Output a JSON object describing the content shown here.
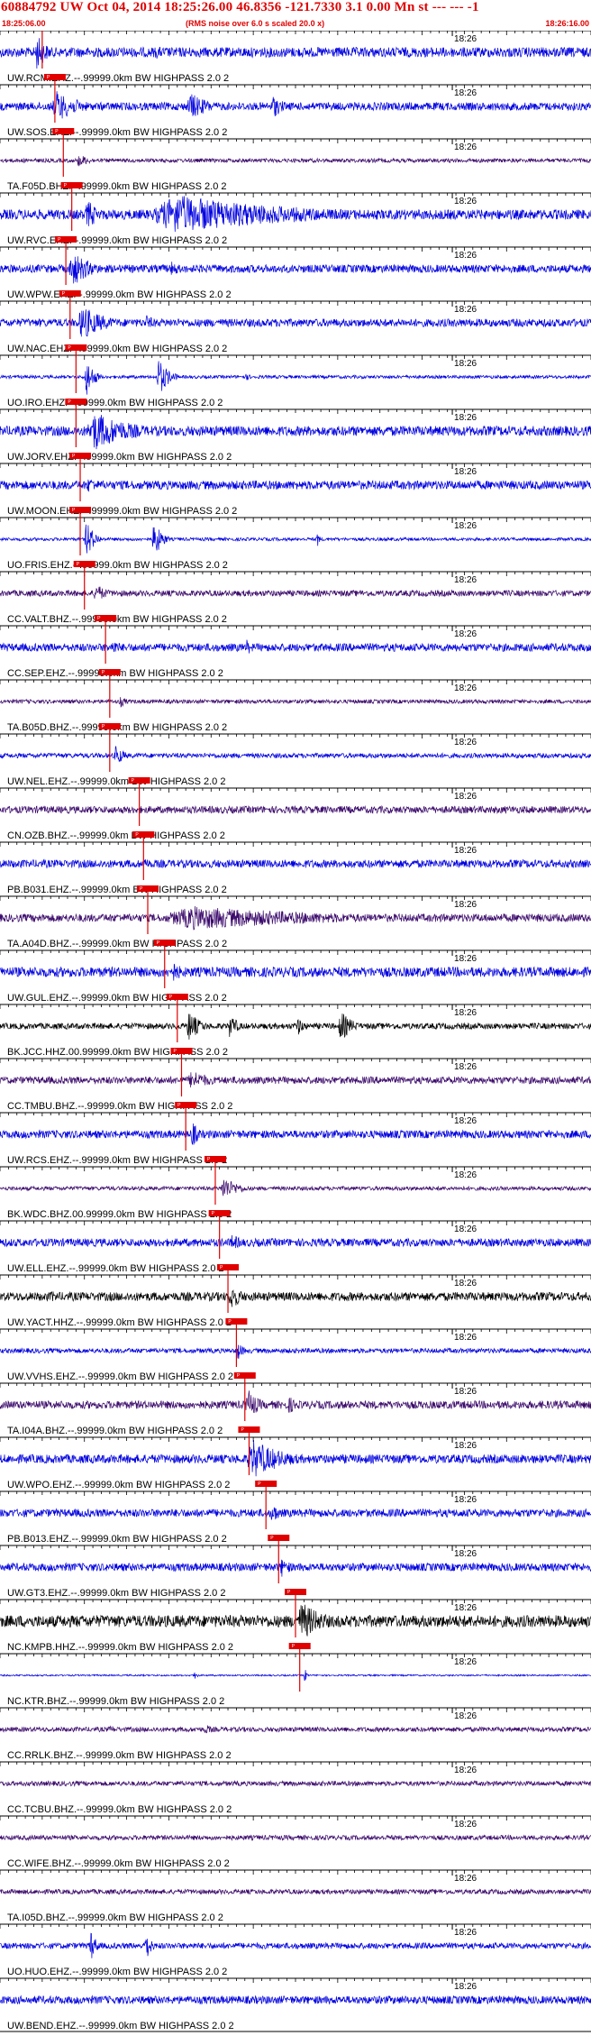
{
  "header": {
    "title": "60884792 UW Oct 04, 2014 18:25:26.00   46.8356 -121.7330  3.1 0.00 Mn st --- --- -1",
    "start_time": "18:25:06.00",
    "end_time": "18:26:16.00",
    "note": "(RMS noise over 6.0 s scaled 20.0 x)"
  },
  "colors": {
    "blue": "#0000e0",
    "purple": "#3b0a6b",
    "black": "#000000",
    "pick": "#e00000",
    "tick": "#000000"
  },
  "chart_data": {
    "type": "seismogram",
    "time_start_s": 0,
    "time_end_s": 70,
    "minute_mark_label": "18:26",
    "minute_mark_s": 54,
    "pick_tag": "P",
    "traces": [
      {
        "label": "UW.RCM.EHZ.--.99999.0km BW  HIGHPASS  2.0  2",
        "color": "blue",
        "pick": 5,
        "events": [
          [
            4,
            3,
            0.9
          ],
          [
            18,
            4,
            0.35
          ]
        ],
        "noise": 0.25
      },
      {
        "label": "UW.SOS.EHZ.--.99999.0km BW  HIGHPASS  2.0  2",
        "color": "blue",
        "pick": 6.5,
        "events": [
          [
            6,
            6,
            0.8
          ],
          [
            22,
            5,
            0.7
          ],
          [
            32,
            3,
            0.6
          ]
        ],
        "noise": 0.2
      },
      {
        "label": "TA.F05D.BHZ.--.99999.0km BW  HIGHPASS  2.0  2",
        "color": "purple",
        "pick": 7.5,
        "events": [
          [
            9,
            3,
            0.35
          ]
        ],
        "noise": 0.1
      },
      {
        "label": "UW.RVC.EHZ.--.99999.0km BW  HIGHPASS  2.0  2",
        "color": "blue",
        "pick": 8.5,
        "events": [
          [
            10,
            3,
            0.8
          ],
          [
            17,
            32,
            1.0
          ]
        ],
        "noise": 0.25
      },
      {
        "label": "UW.WPW.EHZ.--.99999.0km BW  HIGHPASS  2.0  2",
        "color": "blue",
        "pick": 7.8,
        "events": [
          [
            8,
            5,
            0.9
          ],
          [
            20,
            3,
            0.4
          ]
        ],
        "noise": 0.2
      },
      {
        "label": "UW.NAC.EHZ.--.99999.0km BW  HIGHPASS  2.0  2",
        "color": "blue",
        "pick": 8.3,
        "events": [
          [
            9,
            6,
            0.9
          ],
          [
            17,
            3,
            0.4
          ]
        ],
        "noise": 0.2
      },
      {
        "label": "UO.IRO.EHZ.--.99999.0km BW  HIGHPASS  2.0  2",
        "color": "blue",
        "pick": 9,
        "events": [
          [
            10,
            2,
            1.0
          ],
          [
            18.5,
            2.5,
            1.0
          ],
          [
            29,
            1.5,
            0.2
          ]
        ],
        "noise": 0.08
      },
      {
        "label": "UW.JORV.EHZ.--.99999.0km BW  HIGHPASS  2.0  2",
        "color": "blue",
        "pick": 9,
        "events": [
          [
            10,
            10,
            1.0
          ]
        ],
        "noise": 0.25
      },
      {
        "label": "UW.MOON.EHZ.--.99999.0km BW  HIGHPASS  2.0  2",
        "color": "blue",
        "pick": 9.5,
        "events": [
          [
            10,
            4,
            0.4
          ]
        ],
        "noise": 0.22
      },
      {
        "label": "UO.FRIS.EHZ.--.99999.0km BW  HIGHPASS  2.0  2",
        "color": "blue",
        "pick": 9.5,
        "events": [
          [
            10,
            2,
            1.0
          ],
          [
            18,
            2,
            1.0
          ],
          [
            37.5,
            0.5,
            0.6
          ]
        ],
        "noise": 0.08
      },
      {
        "label": "CC.VALT.BHZ.--.99999.0km BW  HIGHPASS  2.0  2",
        "color": "purple",
        "pick": 10,
        "events": [
          [
            11,
            3,
            0.5
          ]
        ],
        "noise": 0.15
      },
      {
        "label": "CC.SEP.EHZ.--.99999.0km BW  HIGHPASS  2.0  2",
        "color": "blue",
        "pick": 12.5,
        "events": [
          [
            13,
            3,
            0.4
          ],
          [
            29,
            2,
            0.4
          ]
        ],
        "noise": 0.2
      },
      {
        "label": "TA.B05D.BHZ.--.99999.0km BW  HIGHPASS  2.0  2",
        "color": "purple",
        "pick": 13,
        "events": [
          [
            14,
            2,
            0.3
          ]
        ],
        "noise": 0.1
      },
      {
        "label": "UW.NEL.EHZ.--.99999.0km BW  HIGHPASS  2.0  2",
        "color": "blue",
        "pick": 13,
        "events": [
          [
            13.5,
            2,
            0.6
          ]
        ],
        "noise": 0.12
      },
      {
        "label": "CN.OZB.BHZ.--.99999.0km BW  HIGHPASS  2.0  2",
        "color": "purple",
        "pick": 16.5,
        "events": [],
        "noise": 0.18
      },
      {
        "label": "PB.B031.EHZ.--.99999.0km BW  HIGHPASS  2.0  2",
        "color": "blue",
        "pick": 17,
        "events": [
          [
            17,
            1,
            0.5
          ]
        ],
        "noise": 0.2
      },
      {
        "label": "TA.A04D.BHZ.--.99999.0km BW  HIGHPASS  2.0  2",
        "color": "purple",
        "pick": 17.5,
        "events": [
          [
            18,
            40,
            0.6
          ]
        ],
        "noise": 0.2
      },
      {
        "label": "UW.GUL.EHZ.--.99999.0km BW  HIGHPASS  2.0  2",
        "color": "blue",
        "pick": 19.5,
        "events": [
          [
            20,
            3,
            0.6
          ]
        ],
        "noise": 0.25
      },
      {
        "label": "BK.JCC.HHZ.00.99999.0km BW  HIGHPASS  2.0  2",
        "color": "black",
        "pick": 21,
        "events": [
          [
            22,
            3,
            0.8
          ],
          [
            27,
            2,
            0.7
          ],
          [
            35,
            2,
            0.5
          ],
          [
            40,
            3,
            0.8
          ]
        ],
        "noise": 0.15
      },
      {
        "label": "CC.TMBU.BHZ.--.99999.0km BW  HIGHPASS  2.0  2",
        "color": "purple",
        "pick": 21.5,
        "events": [
          [
            22,
            6,
            0.5
          ]
        ],
        "noise": 0.18
      },
      {
        "label": "UW.RCS.EHZ.--.99999.0km BW  HIGHPASS  2.0  2",
        "color": "blue",
        "pick": 22,
        "events": [
          [
            22.5,
            2,
            0.7
          ]
        ],
        "noise": 0.2
      },
      {
        "label": "BK.WDC.BHZ.00.99999.0km BW  HIGHPASS  2.0  2",
        "color": "purple",
        "pick": 25.5,
        "events": [
          [
            26,
            4,
            0.6
          ]
        ],
        "noise": 0.1
      },
      {
        "label": "UW.ELL.EHZ.--.99999.0km BW  HIGHPASS  2.0  2",
        "color": "blue",
        "pick": 26,
        "events": [
          [
            27,
            4,
            0.4
          ]
        ],
        "noise": 0.2
      },
      {
        "label": "UW.YACT.HHZ.--.99999.0km BW  HIGHPASS  2.0  2",
        "color": "black",
        "pick": 27,
        "events": [
          [
            6,
            1,
            0.4
          ],
          [
            27,
            3,
            0.7
          ]
        ],
        "noise": 0.22
      },
      {
        "label": "UW.VVHS.EHZ.--.99999.0km BW  HIGHPASS  2.0  2",
        "color": "blue",
        "pick": 28,
        "events": [
          [
            28,
            1.5,
            0.5
          ]
        ],
        "noise": 0.12
      },
      {
        "label": "TA.I04A.BHZ.--.99999.0km BW  HIGHPASS  2.0  2",
        "color": "purple",
        "pick": 29,
        "events": [
          [
            29,
            3,
            0.8
          ],
          [
            34,
            2,
            0.5
          ]
        ],
        "noise": 0.2
      },
      {
        "label": "UW.WPO.EHZ.--.99999.0km BW  HIGHPASS  2.0  2",
        "color": "blue",
        "pick": 29.5,
        "events": [
          [
            29,
            8,
            1.0
          ]
        ],
        "noise": 0.22
      },
      {
        "label": "PB.B013.EHZ.--.99999.0km BW  HIGHPASS  2.0  2",
        "color": "blue",
        "pick": 31.5,
        "events": [
          [
            32,
            2,
            0.6
          ]
        ],
        "noise": 0.2
      },
      {
        "label": "UW.GT3.EHZ.--.99999.0km BW  HIGHPASS  2.0  2",
        "color": "blue",
        "pick": 33,
        "events": [
          [
            33,
            3,
            0.5
          ]
        ],
        "noise": 0.2
      },
      {
        "label": "NC.KMPB.HHZ.--.99999.0km BW  HIGHPASS  2.0  2",
        "color": "black",
        "pick": 35,
        "events": [
          [
            35,
            6,
            1.0
          ]
        ],
        "noise": 0.3
      },
      {
        "label": "NC.KTR.BHZ.--.99999.0km BW  HIGHPASS  2.0  2",
        "color": "blue",
        "pick": 35.5,
        "events": [
          [
            23,
            0.5,
            0.4
          ],
          [
            36,
            0.5,
            0.5
          ]
        ],
        "noise": 0.04
      },
      {
        "label": "CC.RRLK.BHZ.--.99999.0km BW  HIGHPASS  2.0  2",
        "color": "purple",
        "pick": null,
        "events": [
          [
            13,
            1,
            0.3
          ],
          [
            24,
            3,
            0.25
          ]
        ],
        "noise": 0.12
      },
      {
        "label": "CC.TCBU.BHZ.--.99999.0km BW  HIGHPASS  2.0  2",
        "color": "purple",
        "pick": null,
        "events": [],
        "noise": 0.12
      },
      {
        "label": "CC.WIFE.BHZ.--.99999.0km BW  HIGHPASS  2.0  2",
        "color": "purple",
        "pick": null,
        "events": [],
        "noise": 0.12
      },
      {
        "label": "TA.I05D.BHZ.--.99999.0km BW  HIGHPASS  2.0  2",
        "color": "purple",
        "pick": null,
        "events": [],
        "noise": 0.12
      },
      {
        "label": "UO.HUO.EHZ.--.99999.0km BW  HIGHPASS  2.0  2",
        "color": "blue",
        "pick": null,
        "events": [
          [
            10.5,
            1.5,
            0.9
          ],
          [
            17,
            1.5,
            0.9
          ]
        ],
        "noise": 0.15
      },
      {
        "label": "UW.BEND.EHZ.--.99999.0km BW  HIGHPASS  2.0  2",
        "color": "blue",
        "pick": null,
        "events": [],
        "noise": 0.2
      }
    ]
  }
}
